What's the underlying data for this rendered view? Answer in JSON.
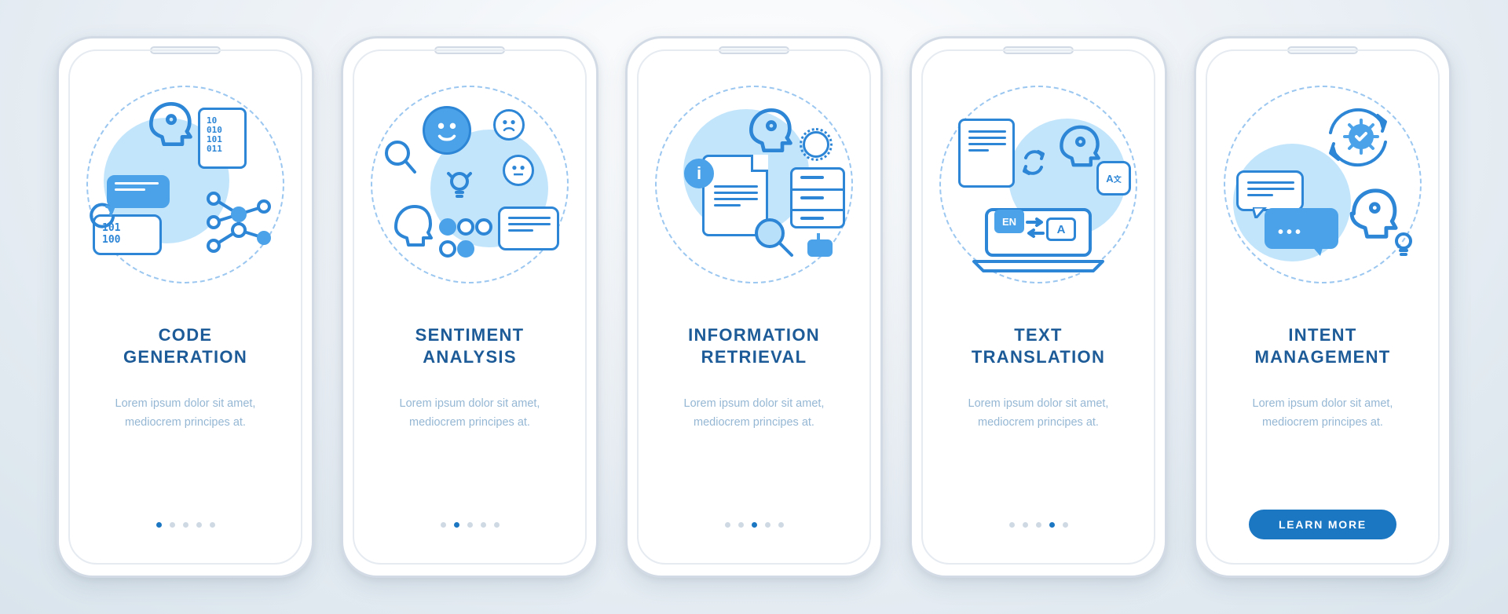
{
  "colors": {
    "primary": "#1c77c3",
    "line": "#2d86d6",
    "soft": "#b9e0fb"
  },
  "common_desc": "Lorem ipsum dolor sit amet, mediocrem principes at.",
  "cta_label": "LEARN MORE",
  "slides": [
    {
      "icon": "code-generation-icon",
      "title_l1": "CODE",
      "title_l2": "GENERATION"
    },
    {
      "icon": "sentiment-analysis-icon",
      "title_l1": "SENTIMENT",
      "title_l2": "ANALYSIS"
    },
    {
      "icon": "information-retrieval-icon",
      "title_l1": "INFORMATION",
      "title_l2": "RETRIEVAL"
    },
    {
      "icon": "text-translation-icon",
      "title_l1": "TEXT",
      "title_l2": "TRANSLATION"
    },
    {
      "icon": "intent-management-icon",
      "title_l1": "INTENT",
      "title_l2": "MANAGEMENT"
    }
  ],
  "dot_count": 5
}
